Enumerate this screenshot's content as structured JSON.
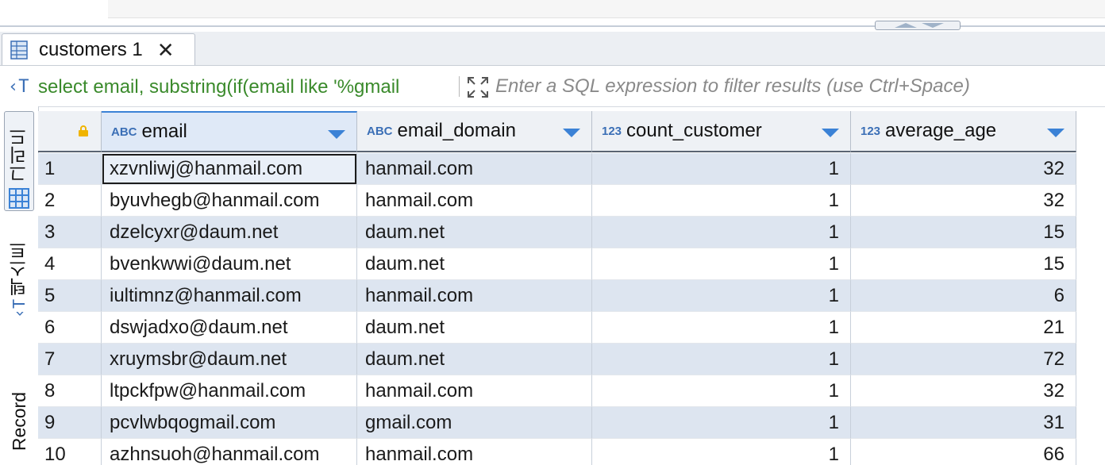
{
  "tab": {
    "label": "customers 1",
    "close": "✕"
  },
  "filter": {
    "sql_icon": "‹T",
    "sql_text": "select email, substring(if(email like '%gmail",
    "placeholder": "Enter a SQL expression to filter results (use Ctrl+Space)"
  },
  "side_tabs": {
    "grid": "그리드",
    "text": "텍스트",
    "record": "Record"
  },
  "columns": [
    {
      "type": "ABC",
      "name": "email"
    },
    {
      "type": "ABC",
      "name": "email_domain"
    },
    {
      "type": "123",
      "name": "count_customer"
    },
    {
      "type": "123",
      "name": "average_age"
    }
  ],
  "rows": [
    {
      "n": "1",
      "email": "xzvnliwj@hanmail.com",
      "domain": "hanmail.com",
      "count": "1",
      "age": "32"
    },
    {
      "n": "2",
      "email": "byuvhegb@hanmail.com",
      "domain": "hanmail.com",
      "count": "1",
      "age": "32"
    },
    {
      "n": "3",
      "email": "dzelcyxr@daum.net",
      "domain": "daum.net",
      "count": "1",
      "age": "15"
    },
    {
      "n": "4",
      "email": "bvenkwwi@daum.net",
      "domain": "daum.net",
      "count": "1",
      "age": "15"
    },
    {
      "n": "5",
      "email": "iultimnz@hanmail.com",
      "domain": "hanmail.com",
      "count": "1",
      "age": "6"
    },
    {
      "n": "6",
      "email": "dswjadxo@daum.net",
      "domain": "daum.net",
      "count": "1",
      "age": "21"
    },
    {
      "n": "7",
      "email": "xruymsbr@daum.net",
      "domain": "daum.net",
      "count": "1",
      "age": "72"
    },
    {
      "n": "8",
      "email": "ltpckfpw@hanmail.com",
      "domain": "hanmail.com",
      "count": "1",
      "age": "32"
    },
    {
      "n": "9",
      "email": "pcvlwbqogmail.com",
      "domain": "gmail.com",
      "count": "1",
      "age": "31"
    },
    {
      "n": "10",
      "email": "azhnsuoh@hanmail.com",
      "domain": "hanmail.com",
      "count": "1",
      "age": "66"
    }
  ],
  "colors": {
    "accent": "#3b82d6",
    "sql_green": "#3a8a2b",
    "row_alt": "#dde5f0"
  }
}
